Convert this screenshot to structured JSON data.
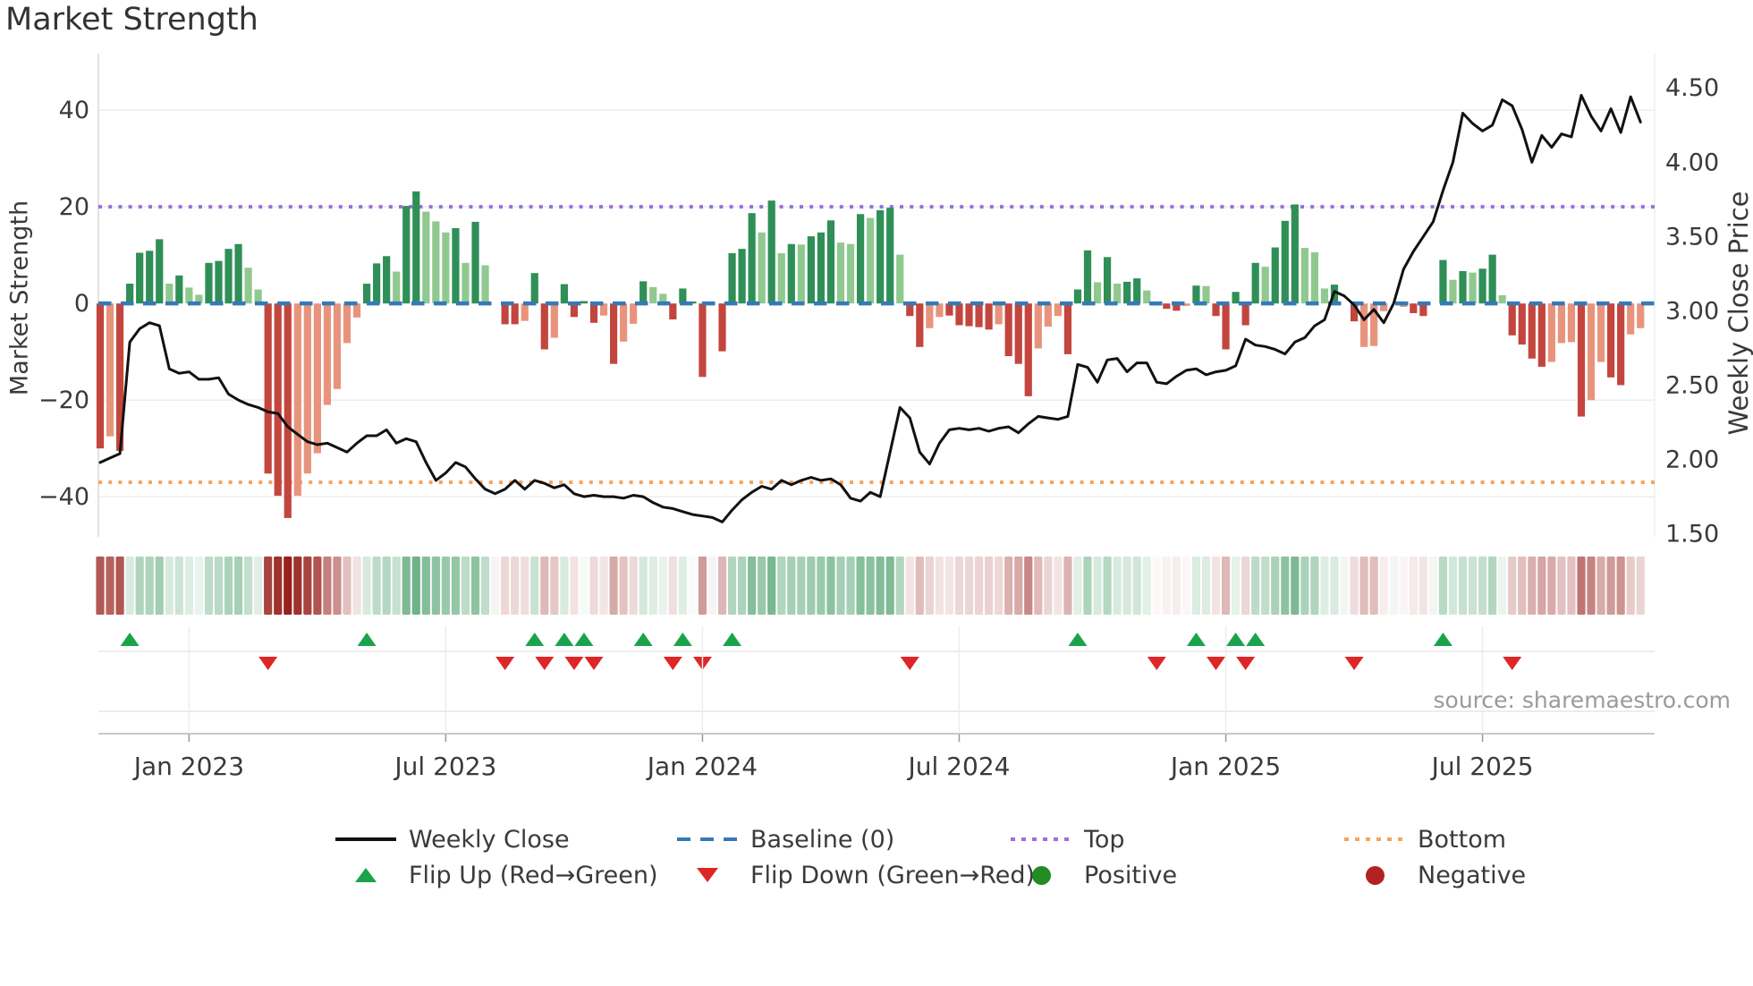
{
  "title": "Market Strength",
  "source_note": "source: sharemaestro.com",
  "axes": {
    "left": {
      "label": "Market Strength",
      "ticks": [
        "40",
        "20",
        "0",
        "−20",
        "−40"
      ],
      "tick_values": [
        40,
        20,
        0,
        -20,
        -40
      ]
    },
    "right": {
      "label": "Weekly Close Price",
      "ticks": [
        "4.50",
        "4.00",
        "3.50",
        "3.00",
        "2.50",
        "2.00",
        "1.50"
      ],
      "tick_values": [
        4.5,
        4.0,
        3.5,
        3.0,
        2.5,
        2.0,
        1.5
      ]
    },
    "x": {
      "tick_labels": [
        "Jan 2023",
        "Jul 2023",
        "Jan 2024",
        "Jul 2024",
        "Jan 2025",
        "Jul 2025"
      ],
      "tick_week_indices": [
        9,
        35,
        61,
        87,
        114,
        140
      ]
    }
  },
  "legend": {
    "items": [
      {
        "icon": "weekly-close-line-icon",
        "label": "Weekly Close"
      },
      {
        "icon": "baseline-dash-icon",
        "label": "Baseline (0)"
      },
      {
        "icon": "top-dotted-icon",
        "label": "Top"
      },
      {
        "icon": "bottom-dotted-icon",
        "label": "Bottom"
      },
      {
        "icon": "flip-up-triangle-icon",
        "label": "Flip Up (Red→Green)"
      },
      {
        "icon": "flip-down-triangle-icon",
        "label": "Flip Down (Green→Red)"
      },
      {
        "icon": "positive-circle-icon",
        "label": "Positive"
      },
      {
        "icon": "negative-circle-icon",
        "label": "Negative"
      }
    ]
  },
  "colors": {
    "bar_positive_dark": "#2f8f57",
    "bar_positive_light": "#90c98f",
    "bar_negative_dark": "#c3463e",
    "bar_negative_light": "#e8947d",
    "baseline": "#3579b8",
    "top_line": "#9a6fdb",
    "bottom_line": "#f4a460",
    "price_line": "#111111",
    "flip_up": "#1aa34c",
    "flip_down": "#df2626",
    "positive_dot": "#228b22",
    "negative_dot": "#b22222",
    "grid": "#ededed",
    "panel_line": "#e6e6e6",
    "axis_line": "#c9c9c9",
    "tick_text": "#3a3a3a"
  },
  "chart_data": {
    "type": "combo",
    "description": "Weekly market-strength bars (left axis) with weekly close price line (right axis), heatmap strip and flip markers",
    "n_weeks": 157,
    "baseline": 0,
    "top_threshold": 20,
    "bottom_threshold": -37,
    "strength_ylim": [
      -48.3,
      51.7
    ],
    "price_ylim": [
      1.48,
      4.73
    ],
    "grid": "horizontal",
    "legend_position": "bottom",
    "strength_bars": [
      -30,
      -27.5,
      -30.5,
      4.1,
      10.5,
      10.9,
      13.3,
      4.1,
      5.8,
      3.3,
      1.8,
      8.4,
      8.8,
      11.3,
      12.3,
      7.4,
      2.9,
      -35.2,
      -39.8,
      -44.4,
      -39.8,
      -35.2,
      -31,
      -21,
      -17.7,
      -8.2,
      -2.9,
      4.1,
      8.3,
      9.8,
      6.6,
      20.2,
      23.2,
      19,
      17,
      14.7,
      15.6,
      8.4,
      16.9,
      7.9,
      0,
      -4.3,
      -4.3,
      -3.6,
      6.3,
      -9.5,
      -7.1,
      4,
      -2.8,
      0.5,
      -4,
      -2.5,
      -12.5,
      -7.9,
      -4.2,
      4.6,
      3.4,
      2,
      -3.3,
      3.1,
      0.4,
      -15.2,
      0,
      -9.9,
      10.4,
      11.3,
      18.7,
      14.7,
      21.3,
      10.4,
      12.3,
      12.2,
      13.9,
      14.7,
      17.2,
      12.6,
      12.3,
      18.5,
      17.7,
      19.3,
      19.8,
      10.1,
      -2.6,
      -9,
      -5.1,
      -2.8,
      -2.5,
      -4.5,
      -4.7,
      -4.9,
      -5.4,
      -4.3,
      -10.9,
      -12.5,
      -19.2,
      -9.3,
      -4.8,
      -2.6,
      -10.5,
      2.9,
      11,
      4.4,
      9.6,
      4.1,
      4.5,
      5.2,
      2.7,
      -0.4,
      -1.1,
      -1.5,
      -0.5,
      3.7,
      3.6,
      -2.6,
      -9.5,
      2.4,
      -4.5,
      8.4,
      7.6,
      11.6,
      17.1,
      20.5,
      11.5,
      10.6,
      3.1,
      3.9,
      0,
      -3.7,
      -9,
      -8.8,
      -1.6,
      0,
      -0.7,
      -2,
      -2.6,
      0,
      9,
      4.9,
      6.7,
      6.4,
      7.2,
      10.1,
      1.7,
      -6.6,
      -8.5,
      -11.4,
      -13.1,
      -12.1,
      -8.2,
      -8,
      -23.4,
      -20,
      -12.1,
      -15.3,
      -16.9,
      -6.4,
      -5.1
    ],
    "bar_shades": "DLDDDDDLDLLDDDDLLDDDLLLLLLLDDDLDDLLLDLDL0DDLDDLDDDDLDLLDLLDDDD0DDDDLDLDLDDDLLDLDDLDDLLDDDDDLDDDLLLDDDLDLDDLDDDLDLDDDDDLDDDLLLD0DLLL0LDD0DLDLDDLDDDDLLLDLLDDLL",
    "weekly_close": [
      1.98,
      2.01,
      2.04,
      2.79,
      2.88,
      2.92,
      2.9,
      2.61,
      2.58,
      2.59,
      2.54,
      2.54,
      2.55,
      2.44,
      2.4,
      2.37,
      2.35,
      2.32,
      2.31,
      2.22,
      2.17,
      2.12,
      2.1,
      2.11,
      2.08,
      2.05,
      2.11,
      2.16,
      2.16,
      2.2,
      2.11,
      2.14,
      2.12,
      1.98,
      1.86,
      1.91,
      1.98,
      1.95,
      1.87,
      1.8,
      1.77,
      1.8,
      1.86,
      1.8,
      1.86,
      1.84,
      1.81,
      1.83,
      1.77,
      1.75,
      1.76,
      1.75,
      1.75,
      1.74,
      1.76,
      1.75,
      1.71,
      1.68,
      1.67,
      1.65,
      1.63,
      1.62,
      1.61,
      1.58,
      1.66,
      1.73,
      1.78,
      1.82,
      1.8,
      1.86,
      1.83,
      1.86,
      1.88,
      1.86,
      1.87,
      1.83,
      1.74,
      1.72,
      1.78,
      1.75,
      2.05,
      2.35,
      2.28,
      2.05,
      1.97,
      2.11,
      2.2,
      2.21,
      2.2,
      2.21,
      2.19,
      2.21,
      2.22,
      2.18,
      2.24,
      2.29,
      2.28,
      2.27,
      2.29,
      2.64,
      2.62,
      2.52,
      2.67,
      2.68,
      2.59,
      2.65,
      2.65,
      2.52,
      2.51,
      2.56,
      2.6,
      2.61,
      2.57,
      2.59,
      2.6,
      2.63,
      2.81,
      2.77,
      2.76,
      2.74,
      2.71,
      2.79,
      2.82,
      2.9,
      2.94,
      3.13,
      3.1,
      3.04,
      2.94,
      3.01,
      2.92,
      3.05,
      3.28,
      3.4,
      3.5,
      3.6,
      3.81,
      4.0,
      4.33,
      4.26,
      4.21,
      4.25,
      4.42,
      4.38,
      4.22,
      4.0,
      4.18,
      4.1,
      4.19,
      4.17,
      4.45,
      4.31,
      4.21,
      4.36,
      4.2,
      4.44,
      4.27
    ],
    "flip_up_weeks": [
      3,
      27,
      44,
      47,
      49,
      55,
      59,
      64,
      99,
      111,
      115,
      117,
      136
    ],
    "flip_down_weeks": [
      17,
      41,
      45,
      48,
      50,
      58,
      61,
      82,
      107,
      113,
      116,
      127,
      143
    ]
  }
}
